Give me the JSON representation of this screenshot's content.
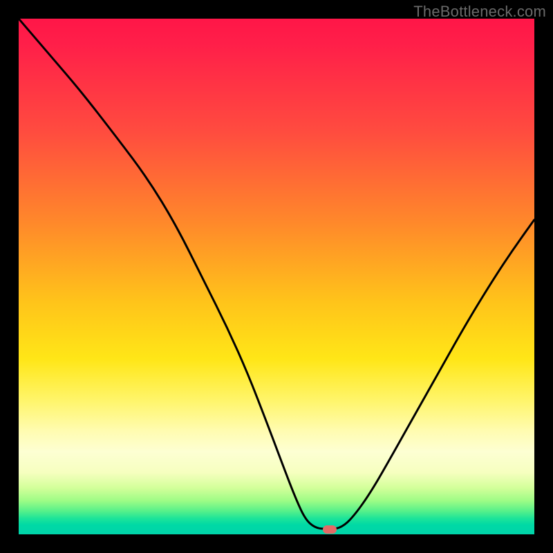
{
  "watermark": "TheBottleneck.com",
  "marker": {
    "x_frac": 0.603,
    "y_frac": 0.9905,
    "color": "#e36a66"
  },
  "curve_color": "#000000",
  "curve_stroke_width": 3,
  "chart_data": {
    "type": "line",
    "title": "",
    "xlabel": "",
    "ylabel": "",
    "xlim": [
      0,
      1
    ],
    "ylim": [
      0,
      1
    ],
    "note": "Axes are unlabeled; values are normalized fractions of the plot area (x right, y up). Curve is a bottleneck V-shape with minimum near x≈0.60.",
    "series": [
      {
        "name": "bottleneck-curve",
        "points": [
          {
            "x": 0.0,
            "y": 1.0
          },
          {
            "x": 0.06,
            "y": 0.93
          },
          {
            "x": 0.12,
            "y": 0.86
          },
          {
            "x": 0.19,
            "y": 0.77
          },
          {
            "x": 0.25,
            "y": 0.69
          },
          {
            "x": 0.305,
            "y": 0.6
          },
          {
            "x": 0.36,
            "y": 0.49
          },
          {
            "x": 0.405,
            "y": 0.4
          },
          {
            "x": 0.445,
            "y": 0.31
          },
          {
            "x": 0.48,
            "y": 0.22
          },
          {
            "x": 0.51,
            "y": 0.14
          },
          {
            "x": 0.535,
            "y": 0.075
          },
          {
            "x": 0.555,
            "y": 0.03
          },
          {
            "x": 0.575,
            "y": 0.012
          },
          {
            "x": 0.6,
            "y": 0.01
          },
          {
            "x": 0.625,
            "y": 0.012
          },
          {
            "x": 0.65,
            "y": 0.035
          },
          {
            "x": 0.685,
            "y": 0.085
          },
          {
            "x": 0.725,
            "y": 0.155
          },
          {
            "x": 0.77,
            "y": 0.235
          },
          {
            "x": 0.815,
            "y": 0.315
          },
          {
            "x": 0.86,
            "y": 0.395
          },
          {
            "x": 0.905,
            "y": 0.47
          },
          {
            "x": 0.95,
            "y": 0.54
          },
          {
            "x": 1.0,
            "y": 0.61
          }
        ]
      }
    ]
  }
}
